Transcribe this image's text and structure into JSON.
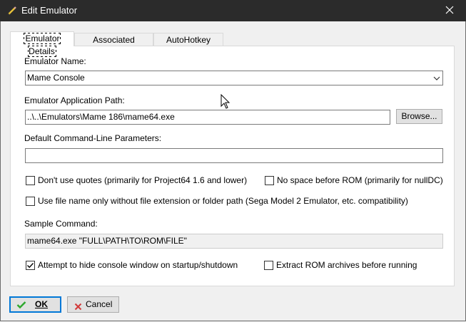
{
  "window": {
    "title": "Edit Emulator"
  },
  "tabs": [
    {
      "label": "Emulator Details",
      "active": true
    },
    {
      "label": "Associated Platforms",
      "active": false
    },
    {
      "label": "AutoHotkey Script",
      "active": false
    }
  ],
  "form": {
    "emulator_name": {
      "label": "Emulator Name:",
      "value": "Mame Console"
    },
    "app_path": {
      "label": "Emulator Application Path:",
      "value": "..\\..\\Emulators\\Mame 186\\mame64.exe",
      "browse_label": "Browse..."
    },
    "params": {
      "label": "Default Command-Line Parameters:",
      "value": ""
    },
    "options": {
      "dont_use_quotes": {
        "label": "Don't use quotes (primarily for Project64 1.6 and lower)",
        "checked": false
      },
      "no_space_before_rom": {
        "label": "No space before ROM (primarily for nullDC)",
        "checked": false
      },
      "file_name_only": {
        "label": "Use file name only without file extension or folder path (Sega Model 2 Emulator, etc. compatibility)",
        "checked": false
      },
      "hide_console": {
        "label": "Attempt to hide console window on startup/shutdown",
        "checked": true
      },
      "extract_archives": {
        "label": "Extract ROM archives before running",
        "checked": false
      }
    },
    "sample_command": {
      "label": "Sample Command:",
      "value": "mame64.exe \"FULL\\PATH\\TO\\ROM\\FILE\""
    }
  },
  "footer": {
    "ok_label": "OK",
    "cancel_label": "Cancel",
    "ok_accent": "#0078d7",
    "ok_icon_color": "#2ea82e",
    "cancel_icon_color": "#d23a3a"
  },
  "icons": {
    "title": "pencil-icon",
    "close": "close-icon",
    "dropdown": "chevron-down-icon",
    "ok": "checkmark-icon",
    "cancel": "x-icon",
    "pointer": "mouse-cursor-icon"
  }
}
